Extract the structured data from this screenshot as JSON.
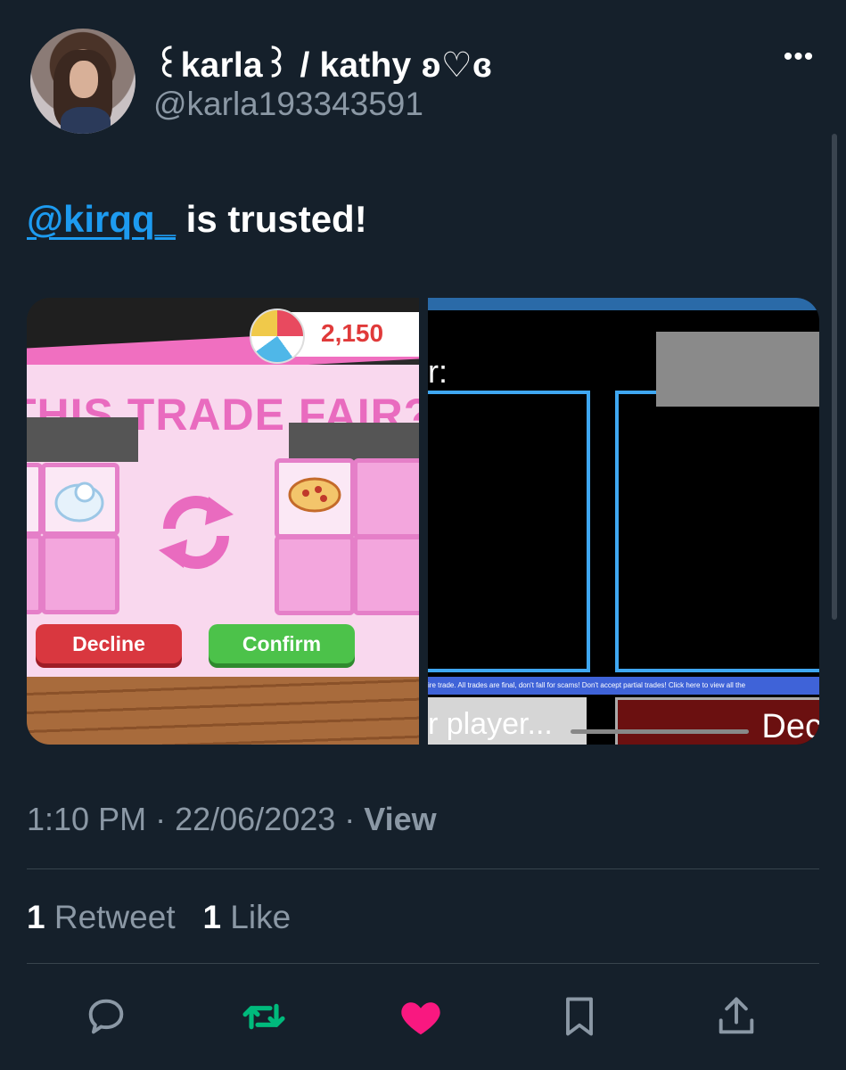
{
  "author": {
    "display_name": "꒰karla꒱ / kathy ʚ♡ɞ",
    "handle": "@karla193343591"
  },
  "tweet": {
    "mention": "@kirqq_",
    "text_rest": " is trusted!"
  },
  "media": {
    "left": {
      "coin_amount": "2,150",
      "title": "THIS TRADE FAIR?",
      "decline_label": "Decline",
      "confirm_label": "Confirm"
    },
    "right": {
      "label": "r:",
      "warning_strip": "ire trade. All trades are final, don't fall for scams! Don't accept partial trades! Click here to view all the",
      "player_button": "r player...",
      "decline_button": "Dec"
    }
  },
  "meta": {
    "time": "1:10 PM",
    "date": "22/06/2023",
    "view_label": "View"
  },
  "stats": {
    "retweets_count": "1",
    "retweets_label": "Retweet",
    "likes_count": "1",
    "likes_label": "Like"
  },
  "icons": {
    "more": "more-icon",
    "reply": "reply-icon",
    "retweet": "retweet-icon",
    "like": "heart-icon",
    "bookmark": "bookmark-icon",
    "share": "share-icon"
  },
  "colors": {
    "background": "#15202b",
    "mention": "#1d9bf0",
    "retweet_active": "#00ba7c",
    "like_active": "#f91880"
  }
}
